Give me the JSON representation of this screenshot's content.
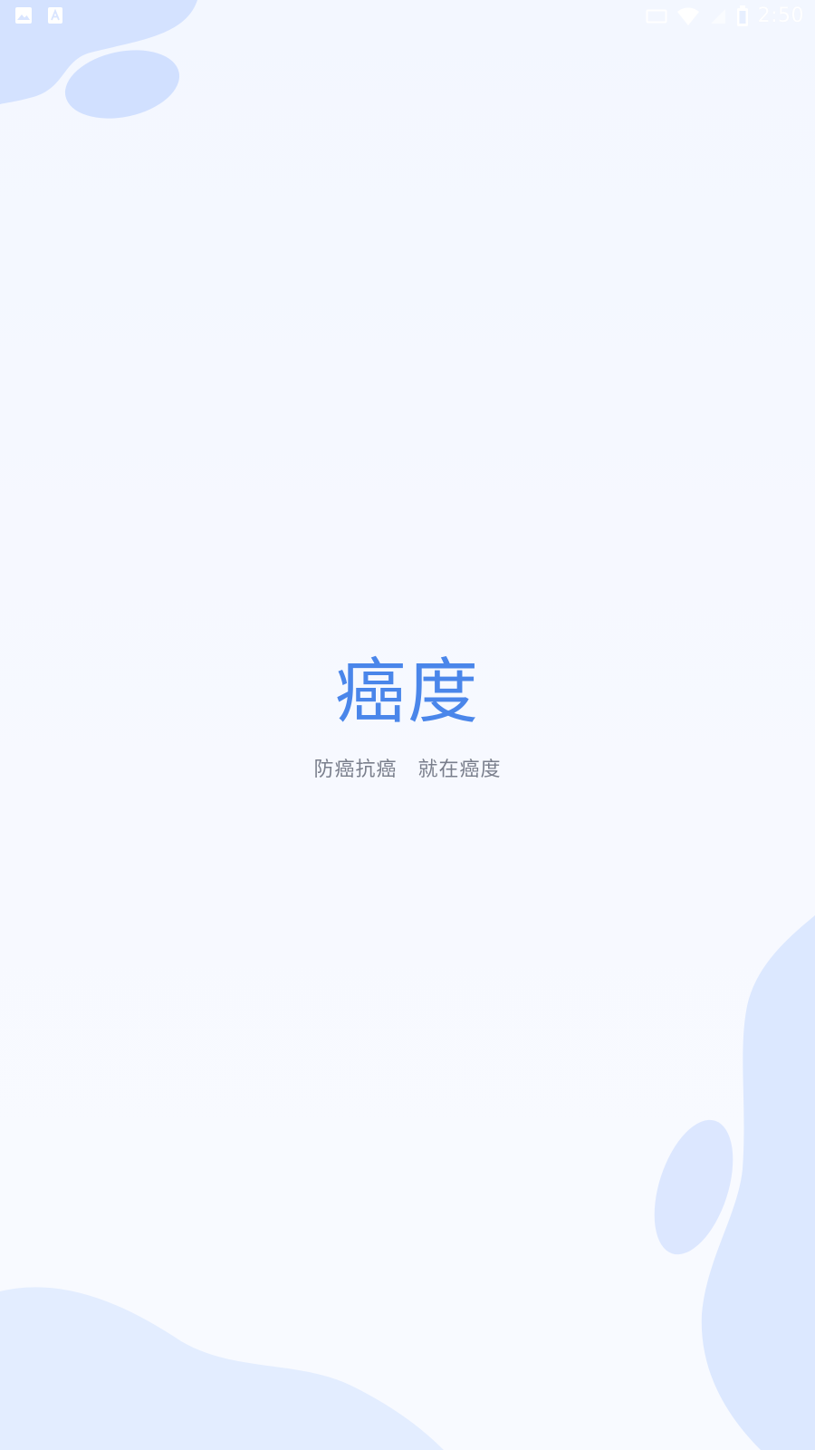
{
  "status_bar": {
    "left_icons": [
      "gallery-notification-icon",
      "app-a-notification-icon"
    ],
    "right_icons": [
      "cast-icon",
      "wifi-icon",
      "signal-icon",
      "battery-icon"
    ],
    "time": "2:50"
  },
  "splash": {
    "title": "癌度",
    "slogan": "防癌抗癌　就在癌度"
  },
  "colors": {
    "brand_blue": "#4a86ea",
    "slogan_gray": "#7a7f8c",
    "blob_dark": "#d4e2ff",
    "blob_light": "#e3edff"
  }
}
